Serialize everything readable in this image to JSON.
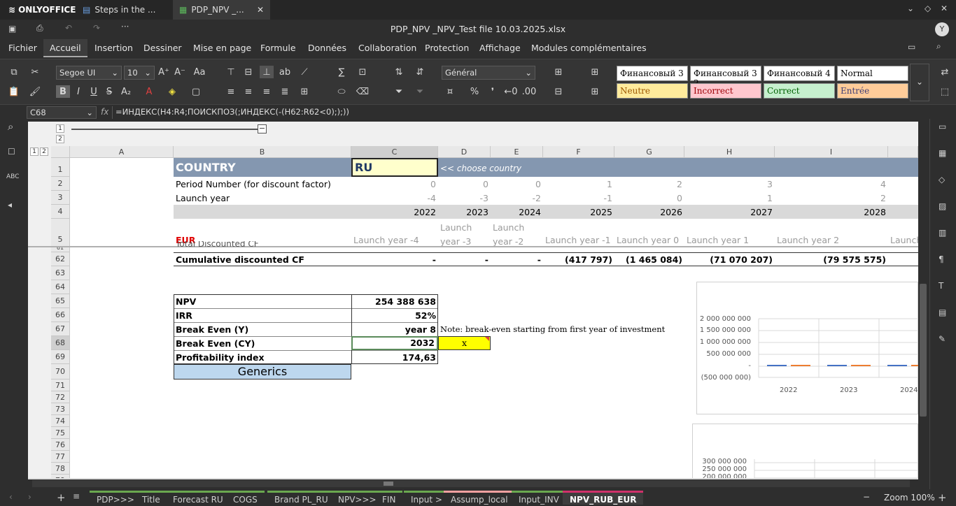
{
  "titlebar": {
    "logo": "ONLYOFFICE",
    "tabs": [
      {
        "label": "Steps in the ..."
      },
      {
        "label": "PDP_NPV _..."
      }
    ],
    "icons": [
      "chevron-down-icon",
      "pin-icon",
      "close-icon"
    ]
  },
  "doc_title": "PDP_NPV _NPV_Test file 10.03.2025.xlsx",
  "user_initial": "Y",
  "menu": [
    "Fichier",
    "Accueil",
    "Insertion",
    "Dessiner",
    "Mise en page",
    "Formule",
    "Données",
    "Collaboration",
    "Protection",
    "Affichage",
    "Modules complémentaires"
  ],
  "ribbon": {
    "font": "Segoe UI",
    "size": "10",
    "format": "Général",
    "styles": [
      {
        "label": "Финансовый 3",
        "bg": "#ffffff",
        "fg": "#000000"
      },
      {
        "label": "Финансовый 3 2",
        "bg": "#ffffff",
        "fg": "#000000"
      },
      {
        "label": "Финансовый 4",
        "bg": "#ffffff",
        "fg": "#000000"
      },
      {
        "label": "Normal",
        "bg": "#ffffff",
        "fg": "#000000"
      },
      {
        "label": "Neutre",
        "bg": "#ffeb9c",
        "fg": "#9c5700"
      },
      {
        "label": "Incorrect",
        "bg": "#ffc7ce",
        "fg": "#9c0006"
      },
      {
        "label": "Correct",
        "bg": "#c6efce",
        "fg": "#006100"
      },
      {
        "label": "Entrée",
        "bg": "#ffcc99",
        "fg": "#3f3f76"
      }
    ]
  },
  "formula": {
    "cellref": "C68",
    "fx": "fx",
    "text": "=ИНДЕКС(H4:R4;ПОИСКПОЗ(;ИНДЕКС(-(H62:R62<0););))"
  },
  "outline": {
    "levels": [
      "1",
      "2"
    ],
    "col_levels": [
      "1",
      "2"
    ]
  },
  "columns": [
    "A",
    "B",
    "C",
    "D",
    "E",
    "F",
    "G",
    "H",
    "I"
  ],
  "rows": [
    "1",
    "2",
    "3",
    "4",
    "5",
    "61",
    "62",
    "63",
    "64",
    "65",
    "66",
    "67",
    "68",
    "69",
    "70",
    "71",
    "72",
    "73",
    "74",
    "75",
    "76",
    "77",
    "78",
    "79"
  ],
  "sheet": {
    "country_label": "COUNTRY",
    "country_value": "RU",
    "choose": "<< choose country",
    "period_label": "Period Number (for discount factor)",
    "period": [
      "0",
      "0",
      "0",
      "1",
      "2",
      "3",
      "4"
    ],
    "launch_label": "Launch year",
    "launch": [
      "-4",
      "-3",
      "-2",
      "-1",
      "0",
      "1",
      "2"
    ],
    "years": [
      "2022",
      "2023",
      "2024",
      "2025",
      "2026",
      "2027",
      "2028"
    ],
    "eur": "EUR",
    "launch_names": [
      "Launch year -4",
      "Launch\nyear -3",
      "Launch\nyear -2",
      "Launch year -1",
      "Launch year 0",
      "Launch year 1",
      "Launch year 2",
      "Launch"
    ],
    "total_label": "Total Discounted CF",
    "cum_label": "Cumulative discounted CF",
    "cum": [
      "-",
      "-",
      "-",
      "(417 797)",
      "(1 465 084)",
      "(71 070 207)",
      "(79 575 575)"
    ],
    "npv_label": "NPV",
    "npv": "254 388 638",
    "irr_label": "IRR",
    "irr": "52%",
    "be_label": "Break Even (Y)",
    "be": "year 8",
    "note": "Note: break-even starting from first year of investment",
    "becy_label": "Break Even (CY)",
    "becy": "2032",
    "x": "x",
    "pi_label": "Profitability index",
    "pi": "174,63",
    "generics": "Generics"
  },
  "charts": [
    {
      "type": "bar",
      "y_ticks": [
        "2 000 000 000",
        "1 500 000 000",
        "1 000 000 000",
        "500 000 000",
        "-",
        "(500 000 000)"
      ],
      "categories": [
        "2022",
        "2023",
        "2024"
      ]
    },
    {
      "type": "bar",
      "y_ticks": [
        "300 000 000",
        "250 000 000",
        "200 000 000"
      ]
    }
  ],
  "sheets": [
    "PDP>>>",
    "Title",
    "Forecast RU",
    "COGS",
    "Brand PL_RU",
    "NPV>>>",
    "FIN",
    "Input >",
    "Assump_local",
    "Input_INV",
    "NPV_RUB_EUR"
  ],
  "zoom": "Zoom 100%"
}
